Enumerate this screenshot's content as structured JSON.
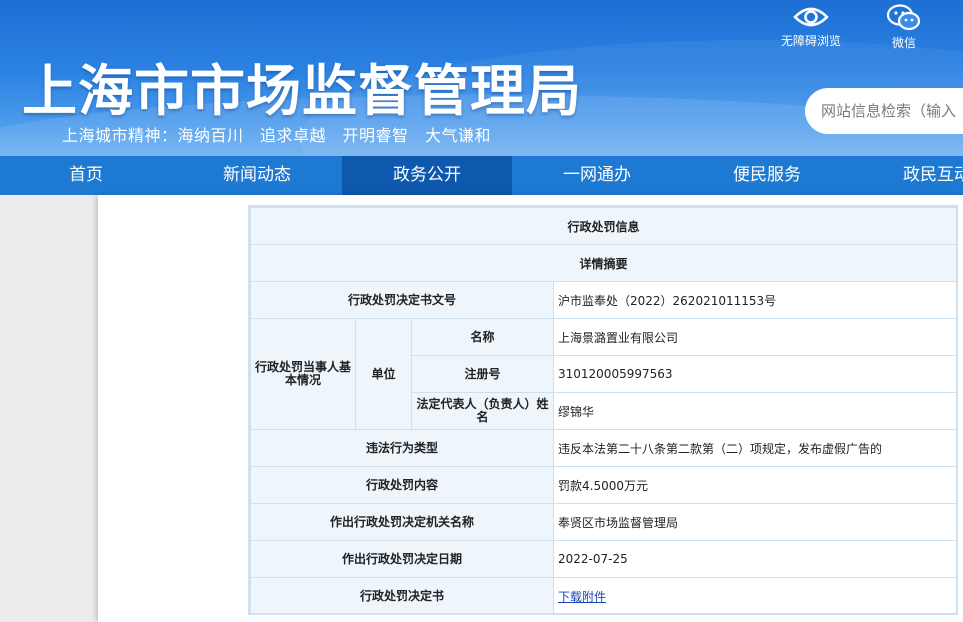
{
  "header": {
    "title": "上海市市场监督管理局",
    "slogan": "上海城市精神：海纳百川　追求卓越　开明睿智　大气谦和",
    "tools": [
      {
        "label": "无障碍浏览",
        "icon": "eye-icon"
      },
      {
        "label": "微信",
        "icon": "wechat-icon"
      }
    ],
    "search_placeholder": "网站信息检索（输入"
  },
  "nav": {
    "items": [
      {
        "label": "首页",
        "active": false
      },
      {
        "label": "新闻动态",
        "active": false
      },
      {
        "label": "政务公开",
        "active": true
      },
      {
        "label": "一网通办",
        "active": false
      },
      {
        "label": "便民服务",
        "active": false
      },
      {
        "label": "政民互动",
        "active": false
      }
    ]
  },
  "penalty": {
    "title": "行政处罚信息",
    "subtitle": "详情摘要",
    "doc_no_label": "行政处罚决定书文号",
    "doc_no": "沪市监奉处（2022）262021011153号",
    "party_label": "行政处罚当事人基本情况",
    "unit_label": "单位",
    "name_label": "名称",
    "name": "上海景潞置业有限公司",
    "reg_label": "注册号",
    "reg_no": "310120005997563",
    "rep_label": "法定代表人（负责人）姓名",
    "rep": "缪锦华",
    "violation_label": "违法行为类型",
    "violation": "违反本法第二十八条第二款第（二）项规定，发布虚假广告的",
    "content_label": "行政处罚内容",
    "content": "罚款4.5000万元",
    "authority_label": "作出行政处罚决定机关名称",
    "authority": "奉贤区市场监督管理局",
    "date_label": "作出行政处罚决定日期",
    "date": "2022-07-25",
    "decision_label": "行政处罚决定书",
    "download": "下载附件"
  }
}
